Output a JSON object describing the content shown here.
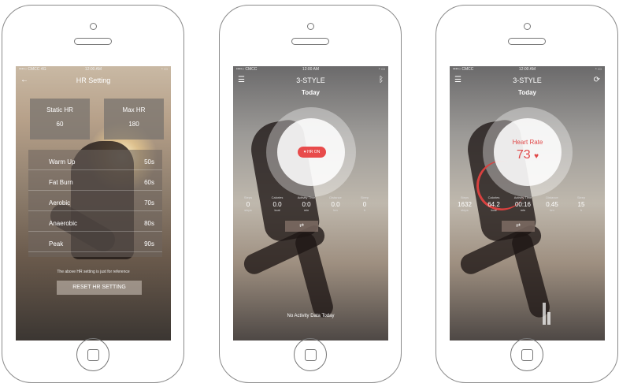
{
  "phones": [
    {
      "header": {
        "back_icon": "arrow-left-icon",
        "title": "HR Setting"
      },
      "resting_hr": {
        "label": "Static HR",
        "value": "60"
      },
      "max_hr": {
        "label": "Max HR",
        "value": "180"
      },
      "zones": [
        {
          "name": "Warm Up",
          "value": "50s"
        },
        {
          "name": "Fat Burn",
          "value": "60s"
        },
        {
          "name": "Aerobic",
          "value": "70s"
        },
        {
          "name": "Anaerobic",
          "value": "80s"
        },
        {
          "name": "Peak",
          "value": "90s"
        }
      ],
      "note": "The above HR setting is just for reference",
      "reset_button": "RESET HR SETTING"
    },
    {
      "header": {
        "menu_icon": "menu-icon",
        "title": "3-STYLE",
        "right_icon": "bluetooth-icon"
      },
      "today": "Today",
      "toggle_label": "HR ON",
      "stats": [
        {
          "label": "Steps",
          "value": "0",
          "unit": "steps"
        },
        {
          "label": "Calories",
          "value": "0.0",
          "unit": "kcal"
        },
        {
          "label": "Activity Time",
          "value": "0:0",
          "unit": "min"
        },
        {
          "label": "Distance",
          "value": "0.0",
          "unit": "km"
        },
        {
          "label": "Sleep",
          "value": "0",
          "unit": "h"
        }
      ],
      "mini_button": "⇄",
      "no_data": "No Activity Data Today"
    },
    {
      "header": {
        "menu_icon": "menu-icon",
        "title": "3-STYLE",
        "right_icon": "sync-icon"
      },
      "today": "Today",
      "heart_rate_label": "Heart Rate",
      "heart_rate_value": "73",
      "stats": [
        {
          "label": "Steps",
          "value": "1632",
          "unit": "steps"
        },
        {
          "label": "Calories",
          "value": "64.2",
          "unit": "kcal"
        },
        {
          "label": "Activity Time",
          "value": "00:16",
          "unit": "min"
        },
        {
          "label": "Distance",
          "value": "0.45",
          "unit": "km"
        },
        {
          "label": "Sleep",
          "value": "15",
          "unit": "h"
        }
      ],
      "mini_button": "⇄"
    }
  ]
}
